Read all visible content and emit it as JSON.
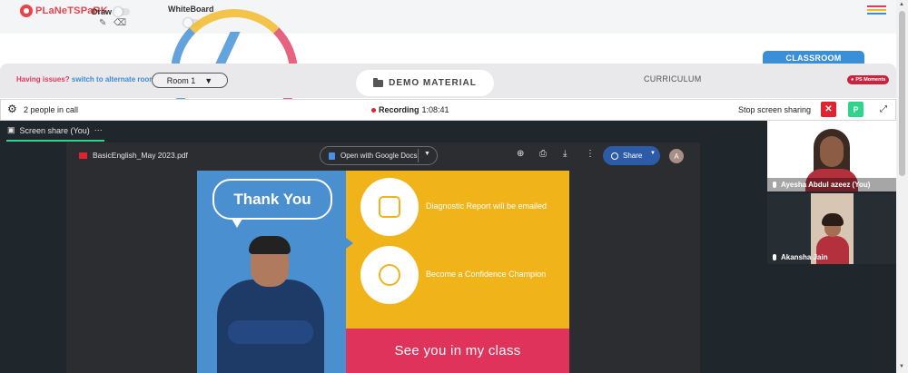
{
  "header": {
    "logo_text": "PLaNeTSPaRK",
    "draw_label": "Draw",
    "whiteboard_label": "WhiteBoard"
  },
  "classroom_bar": {
    "issues_text": "Having issues?",
    "alternate_room_link": "switch to alternate room",
    "room_select_value": "Room 1",
    "demo_material_label": "DEMO MATERIAL",
    "curriculum_label": "CURRICULUM",
    "classroom_tab_label": "CLASSROOM",
    "ps_moments_label": "PS Moments"
  },
  "call_bar": {
    "people_count": "2 people in call",
    "recording_label": "Recording",
    "recording_time": "1:08:41",
    "stop_sharing_label": "Stop screen sharing",
    "participant_initial": "P"
  },
  "share": {
    "tab_label": "Screen share (You)",
    "pdf": {
      "file_name": "BasicEnglish_May 2023.pdf",
      "open_with_label": "Open with Google Docs",
      "share_label": "Share",
      "avatar_initial": "A"
    },
    "slide": {
      "bubble_text": "Thank You",
      "item1": "Diagnostic Report will be emailed",
      "item2": "Become a Confidence Champion",
      "footer": "See you in my class"
    }
  },
  "participants": [
    {
      "name": "Ayesha Abdul azeez (You)"
    },
    {
      "name": "Akansha Jain"
    }
  ],
  "colors": {
    "accent_blue": "#3b8fd6",
    "accent_red": "#e03b5f",
    "slide_yellow": "#f0b41a",
    "slide_pink": "#e0335c",
    "recording_red": "#e0232e",
    "green": "#2fd58b"
  }
}
